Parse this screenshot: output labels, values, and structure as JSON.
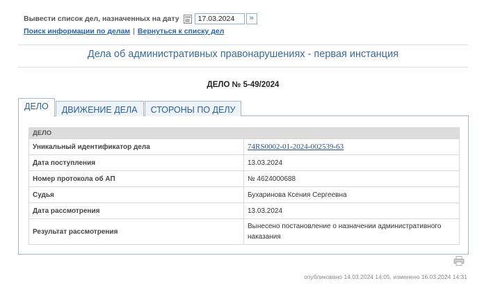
{
  "search": {
    "label": "Вывести список дел, назначенных на дату",
    "date_value": "17.03.2024",
    "go_symbol": "»",
    "link_search": "Поиск информации по делам",
    "link_back": "Вернуться к списку дел"
  },
  "page": {
    "title": "Дела об административных правонарушениях - первая инстанция",
    "case_number": "ДЕЛО № 5-49/2024"
  },
  "tabs": [
    {
      "label": "ДЕЛО",
      "active": true
    },
    {
      "label": "ДВИЖЕНИЕ ДЕЛА",
      "active": false
    },
    {
      "label": "СТОРОНЫ ПО ДЕЛУ",
      "active": false
    }
  ],
  "case_table": {
    "header": "ДЕЛО",
    "rows": [
      {
        "key": "Уникальный идентификатор дела",
        "value": "74RS0002-01-2024-002539-63"
      },
      {
        "key": "Дата поступления",
        "value": "13.03.2024"
      },
      {
        "key": "Номер протокола об АП",
        "value": "№ 4624000688"
      },
      {
        "key": "Судья",
        "value": "Бухаринова Ксения Сергеевна"
      },
      {
        "key": "Дата рассмотрения",
        "value": "13.03.2024"
      },
      {
        "key": "Результат рассмотрения",
        "value": "Вынесено постановление о назначении административного наказания"
      }
    ]
  },
  "footer": {
    "text": "опубликовано 14.03.2024 14:05, изменено 16.03.2024 14:31"
  },
  "icons": {
    "calendar": "calendar-icon",
    "printer": "printer-icon"
  }
}
